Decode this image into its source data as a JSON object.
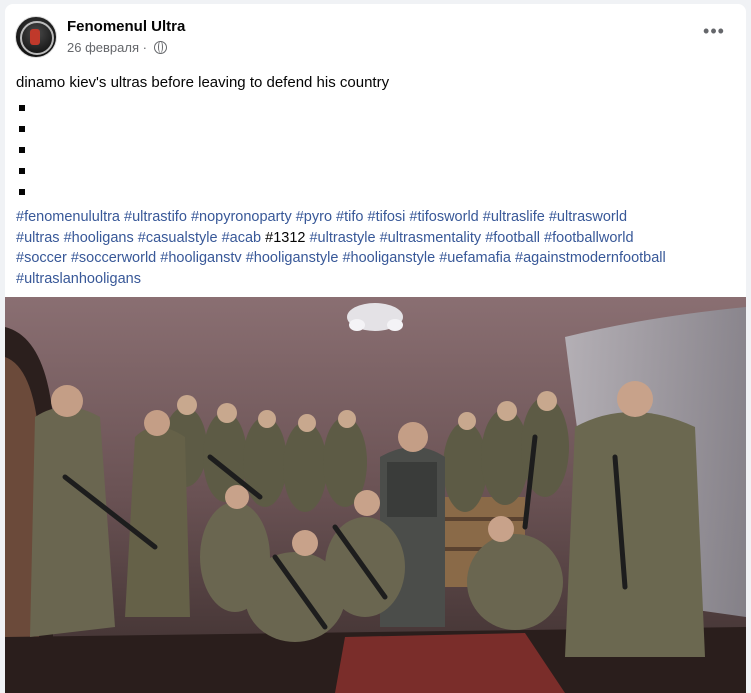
{
  "post": {
    "author": "Fenomenul Ultra",
    "date": "26 февраля",
    "dot": "·",
    "more": "•••",
    "text": "dinamo kiev's ultras before leaving to defend his country",
    "bullet_count": 5,
    "hashtag_lines": [
      [
        "#fenomenulultra",
        "#ultrastifo",
        "#nopyronoparty",
        "#pyro",
        "#tifo",
        "#tifosi",
        "#tifosworld",
        "#ultraslife",
        "#ultrasworld"
      ],
      [
        "#ultras",
        "#hooligans",
        "#casualstyle",
        "#acab",
        "#1312",
        "#ultrastyle",
        "#ultrasmentality",
        "#football",
        "#footballworld"
      ],
      [
        "#soccer",
        "#soccerworld",
        "#hooliganstv",
        "#hooliganstyle",
        "#hooliganstyle",
        "#uefamafia",
        "#againstmodernfootball"
      ],
      [
        "#ultraslanhooligans"
      ]
    ],
    "plain_tags": [
      "#1312"
    ]
  },
  "colors": {
    "link": "#385898",
    "text": "#050505",
    "meta": "#65676b",
    "background": "#f0f2f5"
  },
  "photo": {
    "icon": "group-photo-image"
  }
}
